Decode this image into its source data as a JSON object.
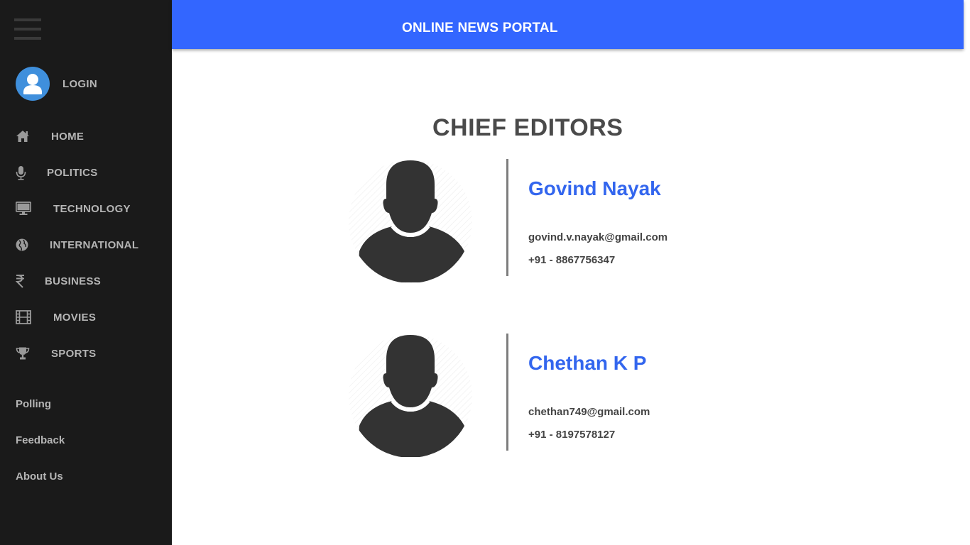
{
  "app": {
    "title": "ONLINE NEWS PORTAL"
  },
  "sidebar": {
    "menu_icon": "hamburger-icon",
    "login": {
      "label": "LOGIN",
      "icon": "user-avatar-icon"
    },
    "nav": [
      {
        "label": "HOME",
        "icon": "home-icon"
      },
      {
        "label": "POLITICS",
        "icon": "microphone-icon"
      },
      {
        "label": "TECHNOLOGY",
        "icon": "desktop-icon"
      },
      {
        "label": "INTERNATIONAL",
        "icon": "globe-icon"
      },
      {
        "label": "BUSINESS",
        "icon": "rupee-icon"
      },
      {
        "label": "MOVIES",
        "icon": "film-icon"
      },
      {
        "label": "SPORTS",
        "icon": "trophy-icon"
      }
    ],
    "links": [
      {
        "label": "Polling"
      },
      {
        "label": "Feedback"
      },
      {
        "label": "About Us"
      }
    ]
  },
  "main": {
    "title": "CHIEF EDITORS",
    "editors": [
      {
        "name": "Govind Nayak",
        "email": "govind.v.nayak@gmail.com",
        "phone": "+91 - 8867756347"
      },
      {
        "name": "Chethan K P",
        "email": "chethan749@gmail.com",
        "phone": "+91 - 8197578127"
      }
    ]
  },
  "colors": {
    "sidebar_bg": "#1a1a1a",
    "header_bg": "#3366ff",
    "accent_name": "#3366ee",
    "avatar_blue": "#3f8fdc",
    "text_dark": "#4a4a4a"
  }
}
